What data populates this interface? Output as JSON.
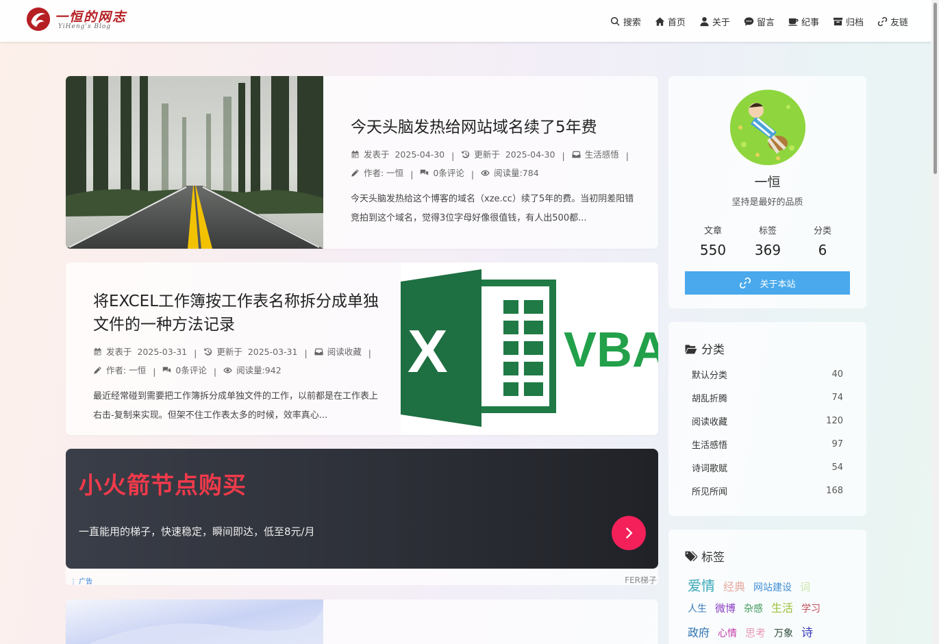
{
  "site": {
    "title": "一恒的网志",
    "subtitle": "YiHeng's Blog"
  },
  "nav": [
    {
      "label": "搜索",
      "icon": "search-icon"
    },
    {
      "label": "首页",
      "icon": "home-icon"
    },
    {
      "label": "关于",
      "icon": "user-icon"
    },
    {
      "label": "留言",
      "icon": "comment-icon"
    },
    {
      "label": "纪事",
      "icon": "coffee-icon"
    },
    {
      "label": "归档",
      "icon": "archive-icon"
    },
    {
      "label": "友链",
      "icon": "link-icon"
    }
  ],
  "posts": [
    {
      "title": "今天头脑发热给网站域名续了5年费",
      "published": "发表于",
      "published_date": "2025-04-30",
      "updated": "更新于",
      "updated_date": "2025-04-30",
      "category": "生活感悟",
      "author": "作者: 一恒",
      "comments": "0条评论",
      "views": "阅读量:784",
      "excerpt": "今天头脑发热给这个博客的域名（xze.cc）续了5年的费。当初阴差阳错竞拍到这个域名，觉得3位字母好像很值钱，有人出500都..."
    },
    {
      "title": "将EXCEL工作簿按工作表名称拆分成单独文件的一种方法记录",
      "published": "发表于",
      "published_date": "2025-03-31",
      "updated": "更新于",
      "updated_date": "2025-03-31",
      "category": "阅读收藏",
      "author": "作者: 一恒",
      "comments": "0条评论",
      "views": "阅读量:942",
      "excerpt": "最近经常碰到需要把工作簿拆分成单独文件的工作，以前都是在工作表上右击-复制来实现。但架不住工作表太多的时候，效率真心..."
    }
  ],
  "thumb2_text": {
    "x": "X",
    "vba": "VBA"
  },
  "ad": {
    "title": "小火箭节点购买",
    "desc": "一直能用的梯子，快速稳定，瞬间即达，低至8元/月",
    "label": "广告",
    "source": "FER梯子"
  },
  "profile": {
    "name": "一恒",
    "motto": "坚持是最好的品质",
    "stats": [
      {
        "label": "文章",
        "value": "550"
      },
      {
        "label": "标签",
        "value": "369"
      },
      {
        "label": "分类",
        "value": "6"
      }
    ],
    "about_label": "关于本站"
  },
  "categories": {
    "heading": "分类",
    "items": [
      {
        "name": "默认分类",
        "count": "40"
      },
      {
        "name": "胡乱折腾",
        "count": "74"
      },
      {
        "name": "阅读收藏",
        "count": "120"
      },
      {
        "name": "生活感悟",
        "count": "97"
      },
      {
        "name": "诗词歌赋",
        "count": "54"
      },
      {
        "name": "所见所闻",
        "count": "168"
      }
    ]
  },
  "tags": {
    "heading": "标签",
    "lines": [
      [
        {
          "name": "爱情",
          "color": "#3aa8b8"
        },
        {
          "name": "经典",
          "color": "#e6a9a0"
        },
        {
          "name": "网站建设",
          "color": "#3f8fd6"
        },
        {
          "name": "词",
          "color": "#c9e6a8"
        }
      ],
      [
        {
          "name": "人生",
          "color": "#3a7dbf"
        },
        {
          "name": "微博",
          "color": "#8a3fc4"
        },
        {
          "name": "杂感",
          "color": "#3f9a5a"
        },
        {
          "name": "生活",
          "color": "#9ac23a"
        },
        {
          "name": "学习",
          "color": "#c4505a"
        }
      ],
      [
        {
          "name": "政府",
          "color": "#2a6fb0"
        },
        {
          "name": "心情",
          "color": "#c43aa8"
        },
        {
          "name": "思考",
          "color": "#e69ab8"
        },
        {
          "name": "万象",
          "color": "#2a4a3a"
        },
        {
          "name": "诗",
          "color": "#3a3ab8"
        }
      ]
    ]
  }
}
